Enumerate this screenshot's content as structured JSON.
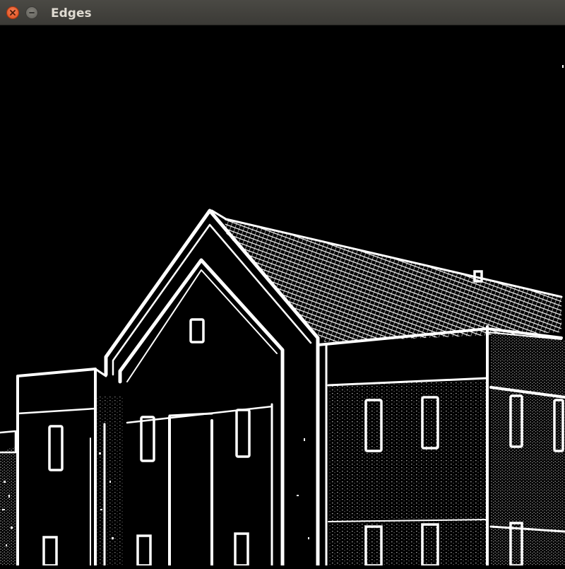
{
  "window": {
    "title": "Edges",
    "close_icon": "close-icon",
    "minimize_icon": "minimize-icon"
  },
  "image": {
    "description_icon": "edge-detection-building-image",
    "background_color": "#000000",
    "edge_color": "#ffffff"
  }
}
